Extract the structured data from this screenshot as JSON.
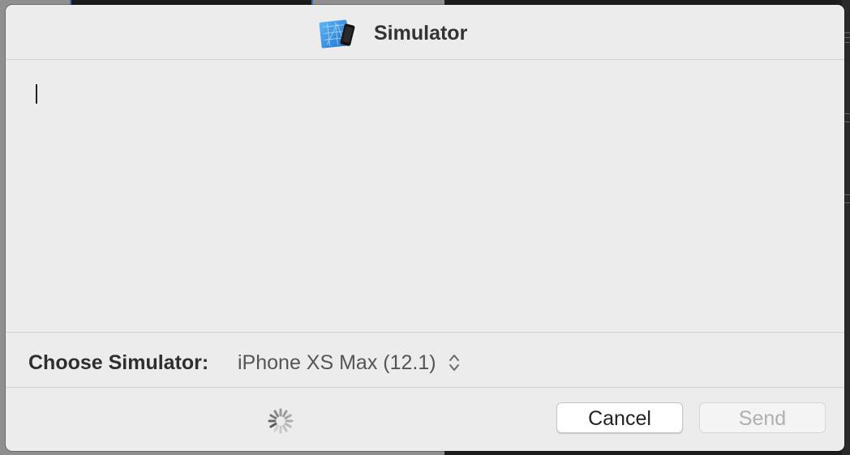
{
  "dialog": {
    "title": "Simulator",
    "app_icon": "simulator-app-icon",
    "message_text": "",
    "chooser": {
      "label": "Choose Simulator:",
      "selected": "iPhone XS Max (12.1)",
      "arrows_icon": "up-down-chevron-icon"
    },
    "status_icon": "loading-spinner-icon",
    "buttons": {
      "cancel": "Cancel",
      "send": "Send"
    }
  },
  "colors": {
    "dialog_background": "#ececec",
    "separator": "#d2d2d2",
    "disabled_text": "#b0b0b0",
    "app_icon_blue": "#2f8ae0"
  }
}
